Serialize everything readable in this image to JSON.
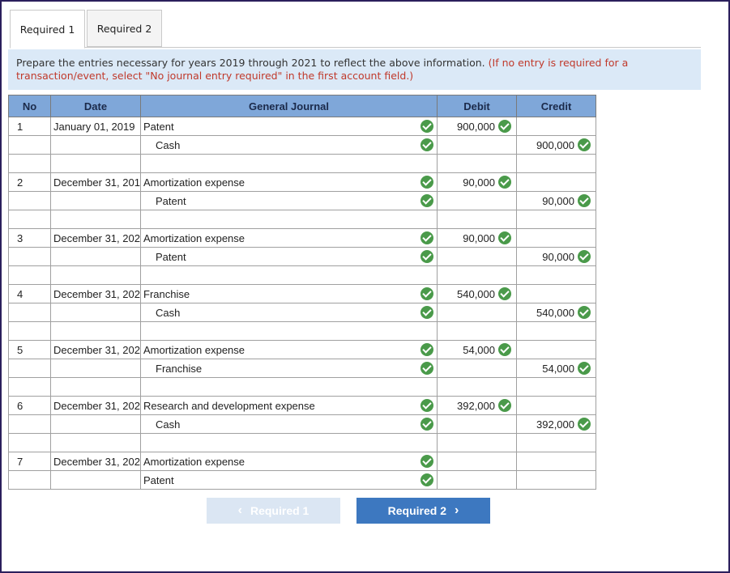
{
  "tabs": [
    {
      "label": "Required 1",
      "active": true
    },
    {
      "label": "Required 2",
      "active": false
    }
  ],
  "instructions": {
    "text": "Prepare the entries necessary for years 2019 through 2021 to reflect the above information.",
    "note": "(If no entry is required for a transaction/event, select \"No journal entry required\" in the first account field.)"
  },
  "table": {
    "headers": {
      "no": "No",
      "date": "Date",
      "journal": "General Journal",
      "debit": "Debit",
      "credit": "Credit"
    },
    "entries": [
      {
        "no": "1",
        "date": "January 01, 2019",
        "debit_account": "Patent",
        "debit": "900,000",
        "credit_account": "Cash",
        "credit": "900,000"
      },
      {
        "no": "2",
        "date": "December 31, 201",
        "debit_account": "Amortization expense",
        "debit": "90,000",
        "credit_account": "Patent",
        "credit": "90,000"
      },
      {
        "no": "3",
        "date": "December 31, 202",
        "debit_account": "Amortization expense",
        "debit": "90,000",
        "credit_account": "Patent",
        "credit": "90,000"
      },
      {
        "no": "4",
        "date": "December 31, 202",
        "debit_account": "Franchise",
        "debit": "540,000",
        "credit_account": "Cash",
        "credit": "540,000"
      },
      {
        "no": "5",
        "date": "December 31, 202",
        "debit_account": "Amortization expense",
        "debit": "54,000",
        "credit_account": "Franchise",
        "credit": "54,000"
      },
      {
        "no": "6",
        "date": "December 31, 202",
        "debit_account": "Research and development expense",
        "debit": "392,000",
        "credit_account": "Cash",
        "credit": "392,000"
      },
      {
        "no": "7",
        "date": "December 31, 202",
        "debit_account": "Amortization expense",
        "debit": "",
        "credit_account": "Patent",
        "credit": ""
      }
    ]
  },
  "buttons": {
    "prev_label": "Required 1",
    "next_label": "Required 2"
  },
  "colors": {
    "header_bg": "#7fa7d9",
    "check_green": "#4a9a4a",
    "next_button": "#3d78c0",
    "note_red": "#c0392b"
  }
}
